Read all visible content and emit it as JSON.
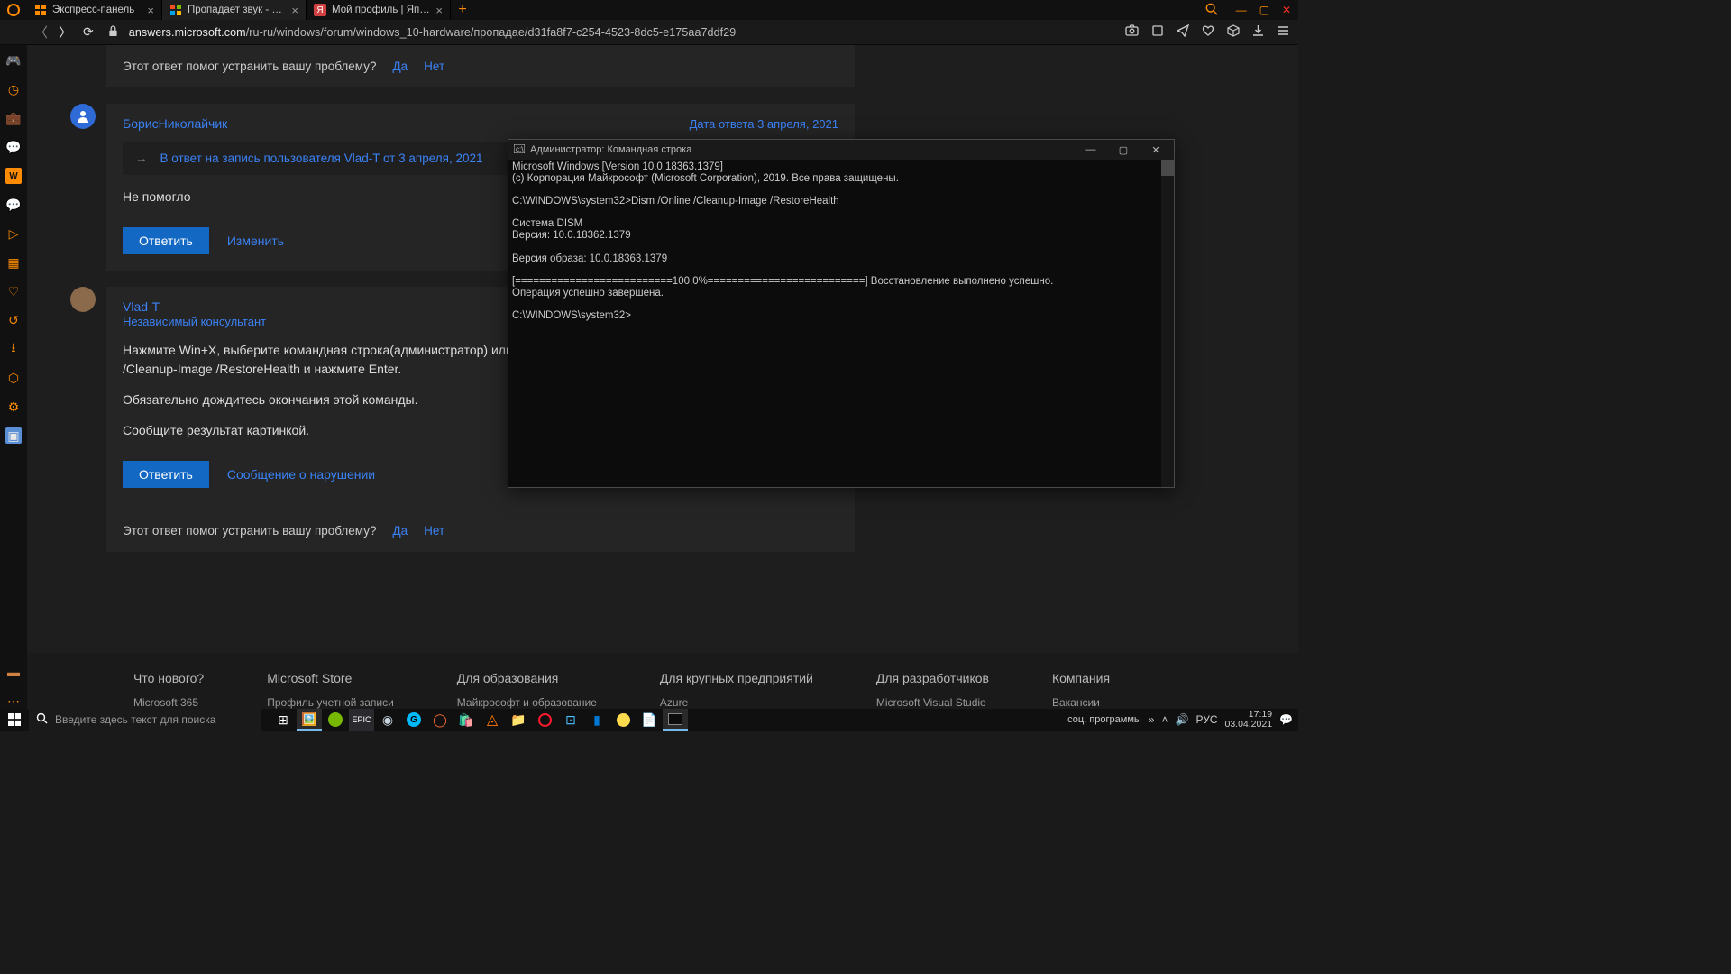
{
  "browser": {
    "tabs": [
      {
        "label": "Экспресс-панель",
        "favicon_color": "#ff8c00"
      },
      {
        "label": "Пропадает звук - Сообщ…",
        "favicon_color": "#00a4ef"
      },
      {
        "label": "Мой профиль | Япикс",
        "favicon_color": "#d04040"
      }
    ],
    "active_tab": 1,
    "url_host": "answers.microsoft.com",
    "url_path": "/ru-ru/windows/forum/windows_10-hardware/пропадае/d31fa8f7-c254-4523-8dc5-e175aa7ddf29"
  },
  "forum": {
    "helpful_prompt": "Этот ответ помог устранить вашу проблему?",
    "yes": "Да",
    "no": "Нет",
    "reply1": {
      "user": "БорисНиколайчик",
      "date": "Дата ответа 3 апреля, 2021",
      "quote": "В ответ на запись пользователя Vlad-T от 3 апреля, 2021",
      "body": "Не помогло",
      "reply_btn": "Ответить",
      "edit": "Изменить"
    },
    "reply2": {
      "user": "Vlad-T",
      "role": "Независимый консультант",
      "p1": "Нажмите Win+X, выберите командная строка(администратор) или PowerShe",
      "p1b": "/Cleanup-Image /RestoreHealth и нажмите Enter.",
      "p2": "Обязательно дождитесь окончания этой команды.",
      "p3": "Сообщите результат картинкой.",
      "reply_btn": "Ответить",
      "report": "Сообщение о нарушении"
    }
  },
  "footer": {
    "c1": {
      "h": "Что нового?",
      "a": "Microsoft 365"
    },
    "c2": {
      "h": "Microsoft Store",
      "a": "Профиль учетной записи"
    },
    "c3": {
      "h": "Для образования",
      "a": "Майкрософт и образование"
    },
    "c4": {
      "h": "Для крупных предприятий",
      "a": "Azure"
    },
    "c5": {
      "h": "Для разработчиков",
      "a": "Microsoft Visual Studio"
    },
    "c6": {
      "h": "Компания",
      "a": "Вакансии"
    }
  },
  "cmd": {
    "title": "Администратор: Командная строка",
    "l1": "Microsoft Windows [Version 10.0.18363.1379]",
    "l2": "(c) Корпорация Майкрософт (Microsoft Corporation), 2019. Все права защищены.",
    "l3": "C:\\WINDOWS\\system32>Dism /Online /Cleanup-Image /RestoreHealth",
    "l4": "Cистема DISM",
    "l5": "Версия: 10.0.18362.1379",
    "l6": "Версия образа: 10.0.18363.1379",
    "l7": "[==========================100.0%==========================] Восстановление выполнено успешно.",
    "l8": "Операция успешно завершена.",
    "l9": "C:\\WINDOWS\\system32>"
  },
  "taskbar": {
    "search_placeholder": "Введите здесь текст для поиска",
    "tray_text": "соц. программы",
    "lang": "РУС",
    "time": "17:19",
    "date": "03.04.2021"
  }
}
